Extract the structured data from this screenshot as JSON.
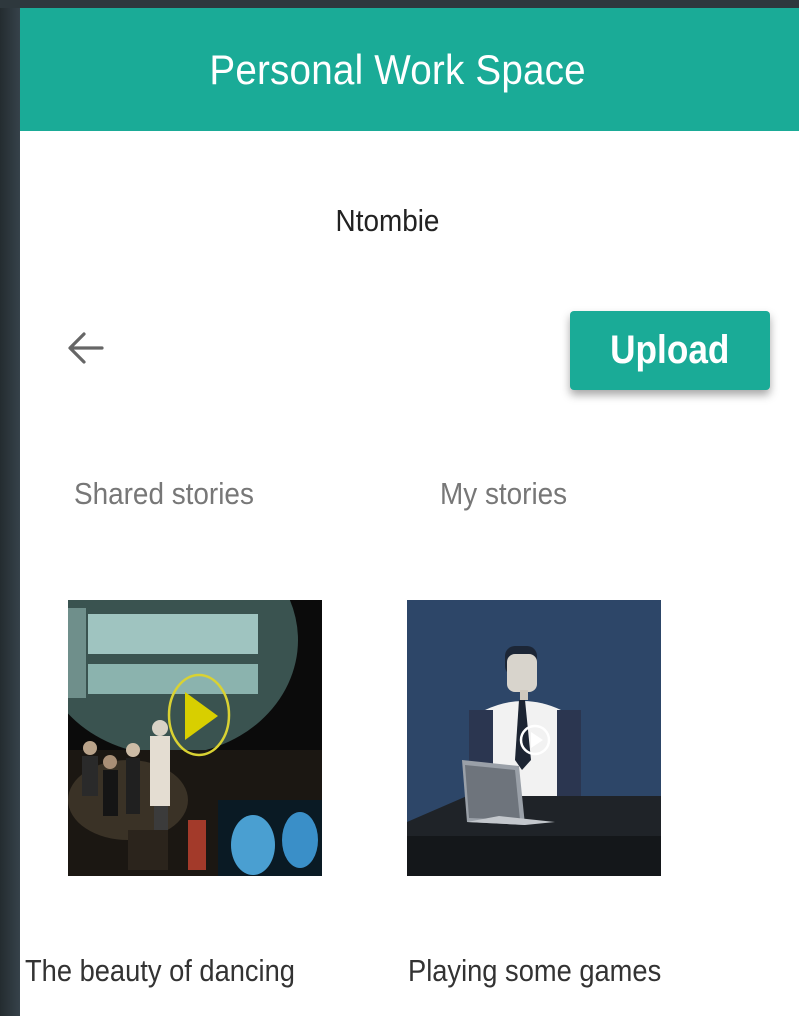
{
  "app": {
    "title": "Personal Work Space",
    "accent_color": "#1aab97"
  },
  "user": {
    "name": "Ntombie"
  },
  "toolbar": {
    "back_icon": "arrow-left-icon",
    "upload_label": "Upload"
  },
  "tabs": [
    {
      "label": "Shared stories"
    },
    {
      "label": "My stories"
    }
  ],
  "stories": [
    {
      "title": "The beauty of dancing",
      "thumbnail": "dance-performance-video-thumbnail",
      "play_icon": "play-icon"
    },
    {
      "title": "Playing some games",
      "thumbnail": "man-at-laptop-video-thumbnail",
      "play_icon": "play-icon"
    }
  ]
}
